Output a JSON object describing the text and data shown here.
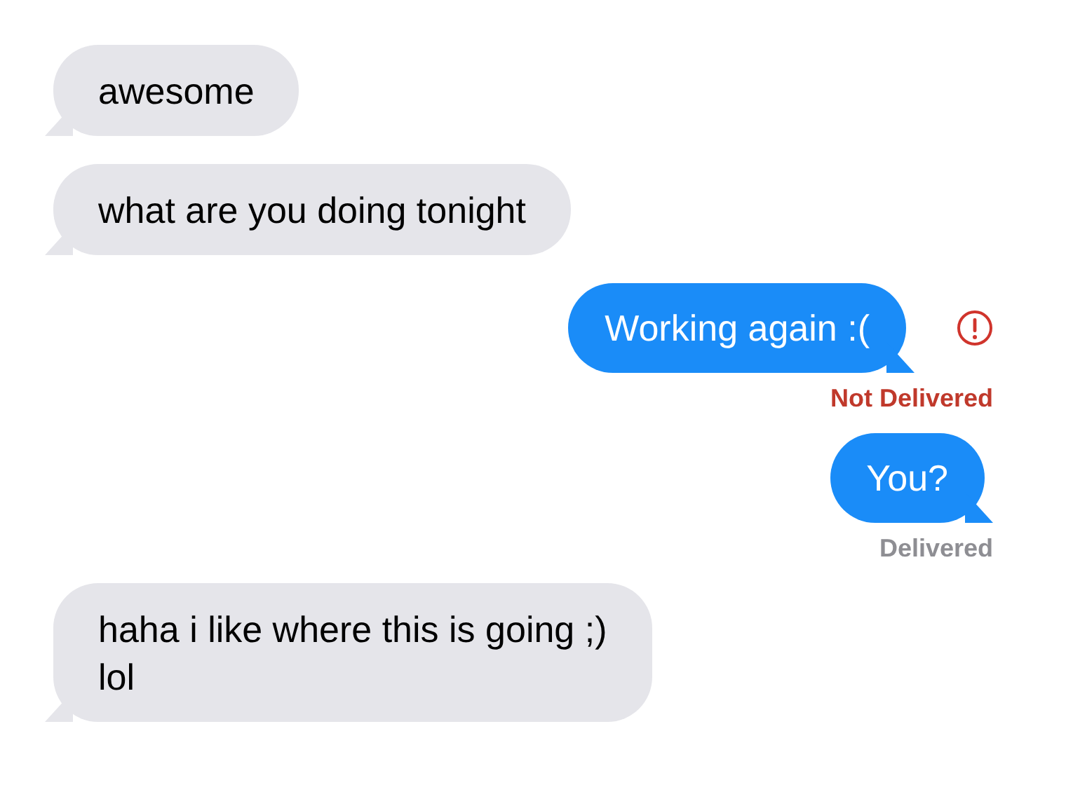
{
  "messages": [
    {
      "kind": "incoming",
      "text": "awesome"
    },
    {
      "kind": "incoming",
      "text": "what are you doing tonight"
    },
    {
      "kind": "outgoing",
      "text": "Working again :(",
      "failed": true,
      "status": "Not Delivered"
    },
    {
      "kind": "outgoing",
      "text": "You?",
      "failed": false,
      "status": "Delivered"
    },
    {
      "kind": "incoming",
      "text": "haha i like where this is going ;)\nlol"
    }
  ]
}
